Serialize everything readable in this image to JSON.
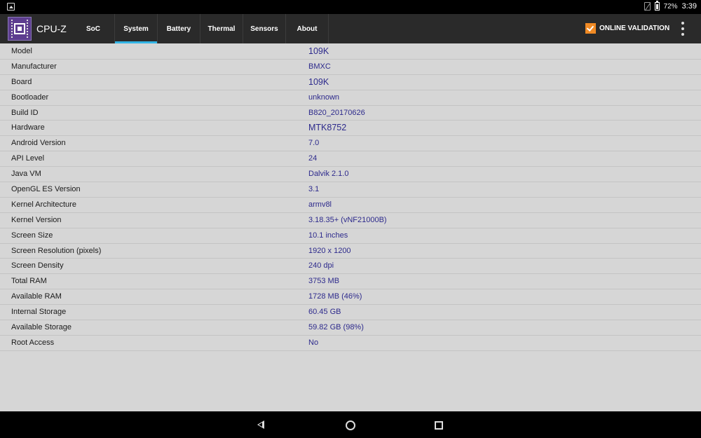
{
  "status_bar": {
    "battery": "72%",
    "time": "3:39"
  },
  "app": {
    "title": "CPU-Z",
    "tabs": [
      {
        "label": "SoC",
        "active": false
      },
      {
        "label": "System",
        "active": true
      },
      {
        "label": "Battery",
        "active": false
      },
      {
        "label": "Thermal",
        "active": false
      },
      {
        "label": "Sensors",
        "active": false
      },
      {
        "label": "About",
        "active": false
      }
    ],
    "validation_label": "ONLINE VALIDATION"
  },
  "system": [
    {
      "label": "Model",
      "value": "109K"
    },
    {
      "label": "Manufacturer",
      "value": "BMXC"
    },
    {
      "label": "Board",
      "value": "109K"
    },
    {
      "label": "Bootloader",
      "value": "unknown"
    },
    {
      "label": "Build ID",
      "value": "B820_20170626"
    },
    {
      "label": "Hardware",
      "value": "MTK8752"
    },
    {
      "label": "Android Version",
      "value": "7.0"
    },
    {
      "label": "API Level",
      "value": "24"
    },
    {
      "label": "Java VM",
      "value": "Dalvik 2.1.0"
    },
    {
      "label": "OpenGL ES Version",
      "value": "3.1"
    },
    {
      "label": "Kernel Architecture",
      "value": "armv8l"
    },
    {
      "label": "Kernel Version",
      "value": "3.18.35+ (vNF21000B)"
    },
    {
      "label": "Screen Size",
      "value": "10.1 inches"
    },
    {
      "label": "Screen Resolution (pixels)",
      "value": "1920 x 1200"
    },
    {
      "label": "Screen Density",
      "value": "240 dpi"
    },
    {
      "label": "Total RAM",
      "value": "3753 MB"
    },
    {
      "label": "Available RAM",
      "value": "1728 MB  (46%)"
    },
    {
      "label": "Internal Storage",
      "value": "60.45 GB"
    },
    {
      "label": "Available Storage",
      "value": "59.82 GB (98%)"
    },
    {
      "label": "Root Access",
      "value": "No"
    }
  ]
}
